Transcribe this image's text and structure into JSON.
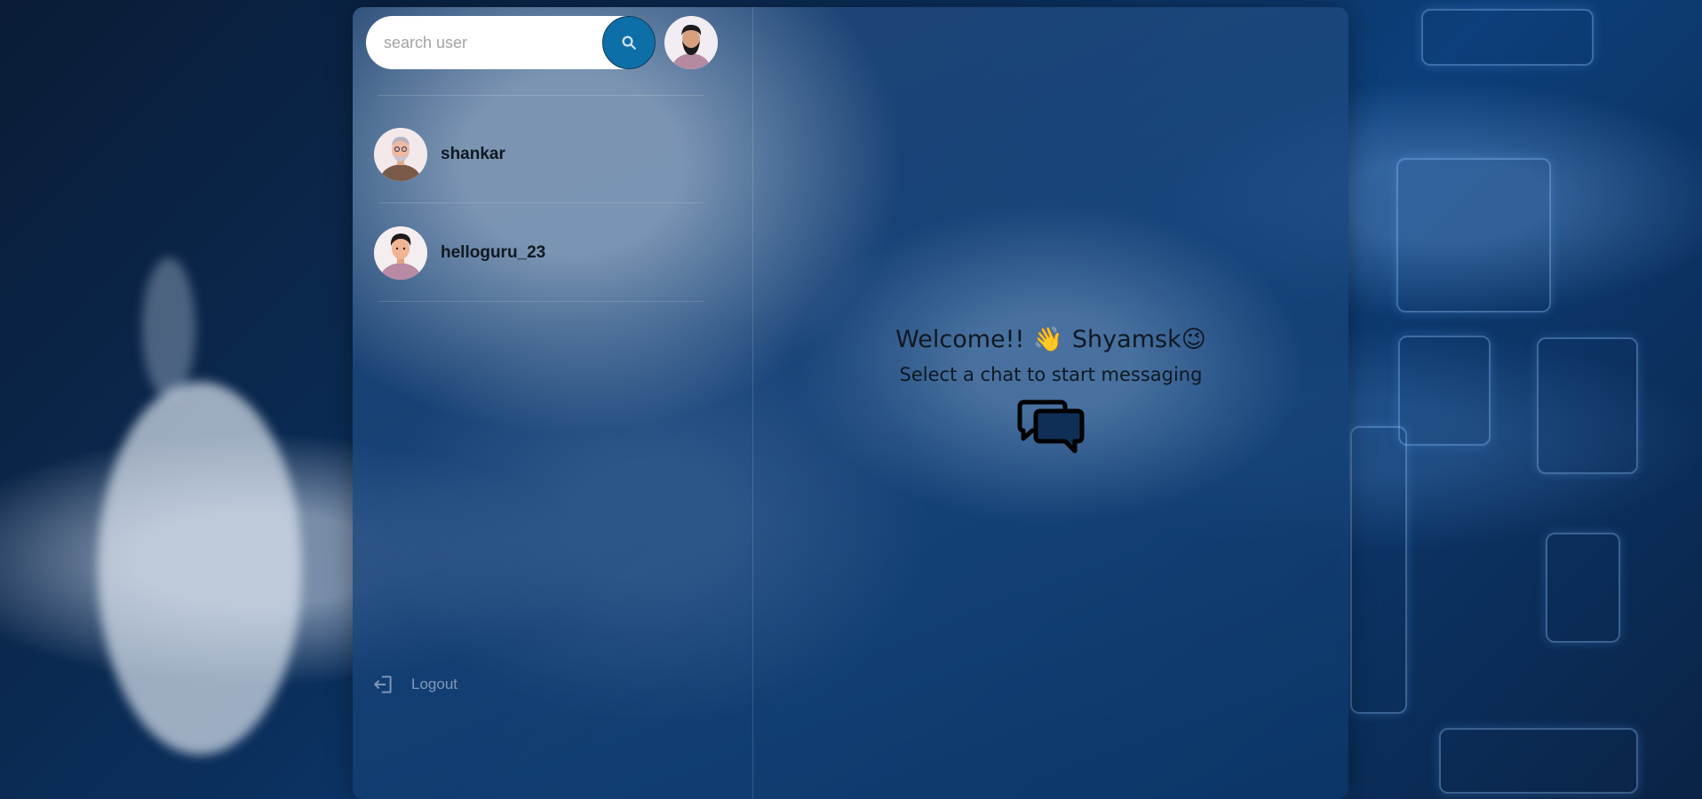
{
  "search": {
    "placeholder": "search user",
    "button_icon": "search-icon"
  },
  "profile": {
    "avatar_icon": "user-avatar"
  },
  "conversations": [
    {
      "name": "shankar",
      "avatar_icon": "user-avatar"
    },
    {
      "name": "helloguru_23",
      "avatar_icon": "user-avatar"
    }
  ],
  "logout": {
    "label": "Logout",
    "icon": "logout-icon"
  },
  "welcome": {
    "greeting": "Welcome!!",
    "wave_emoji": "👋",
    "username": "Shyamsk",
    "wink_emoji": "😉",
    "subtitle": "Select a chat to start messaging",
    "icon": "chat-bubbles-icon"
  },
  "colors": {
    "search_button": "#0e6fa8",
    "text_dark": "#101820"
  }
}
